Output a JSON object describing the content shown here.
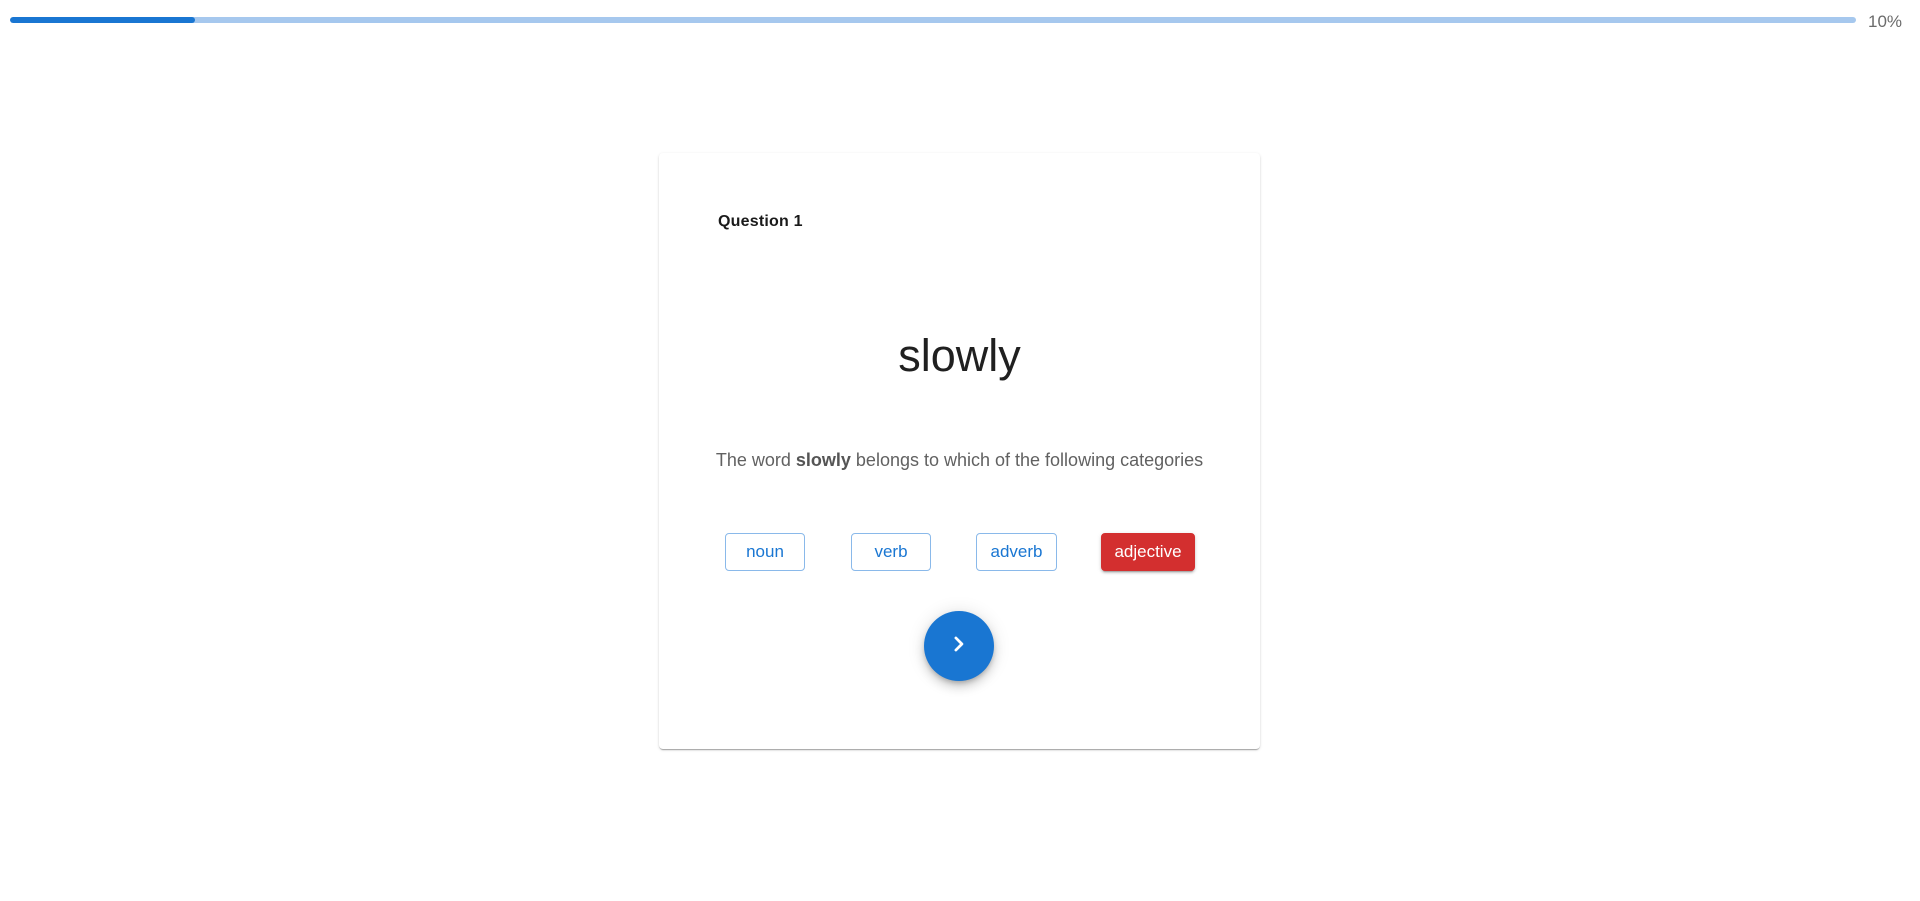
{
  "progress": {
    "value_percent": 10,
    "label": "10%",
    "track_color": "#a6c8ee",
    "fill_color": "#1976d2"
  },
  "card": {
    "question_label": "Question 1",
    "word": "slowly",
    "prompt": {
      "before": "The word ",
      "emphasis": "slowly",
      "after": " belongs to which of the following categories"
    },
    "options": [
      {
        "label": "noun",
        "selected": false
      },
      {
        "label": "verb",
        "selected": false
      },
      {
        "label": "adverb",
        "selected": false
      },
      {
        "label": "adjective",
        "selected": true
      }
    ],
    "selected_color": "#d32f2f",
    "next_button": {
      "icon": "chevron-right-icon",
      "color": "#1976d2"
    }
  }
}
